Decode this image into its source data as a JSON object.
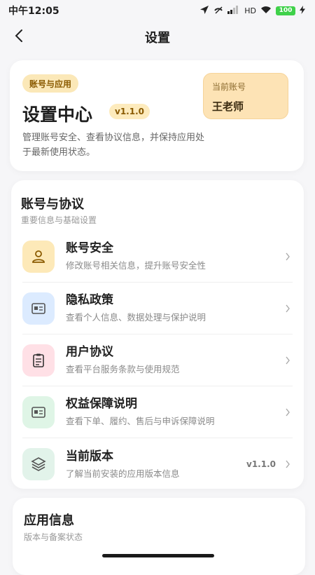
{
  "status_bar": {
    "time": "中午12:05",
    "signal_text": "HD",
    "battery": "100"
  },
  "nav": {
    "title": "设置"
  },
  "hero": {
    "tag": "账号与应用",
    "title": "设置中心",
    "version": "v1.1.0",
    "description": "管理账号安全、查看协议信息，并保持应用处于最新使用状态。",
    "account_label": "当前账号",
    "account_name": "王老师"
  },
  "account_section": {
    "title": "账号与协议",
    "subtitle": "重要信息与基础设置",
    "items": [
      {
        "icon": "user-icon",
        "title": "账号安全",
        "description": "修改账号相关信息，提升账号安全性",
        "value": "",
        "color": "#fde9b8"
      },
      {
        "icon": "id-card-icon",
        "title": "隐私政策",
        "description": "查看个人信息、数据处理与保护说明",
        "value": "",
        "color": "#dcebff"
      },
      {
        "icon": "clipboard-icon",
        "title": "用户协议",
        "description": "查看平台服务条款与使用规范",
        "value": "",
        "color": "#ffe0e6"
      },
      {
        "icon": "id-card-icon",
        "title": "权益保障说明",
        "description": "查看下单、履约、售后与申诉保障说明",
        "value": "",
        "color": "#dff5e6"
      },
      {
        "icon": "layers-icon",
        "title": "当前版本",
        "description": "了解当前安装的应用版本信息",
        "value": "v1.1.0",
        "color": "#e2f3ea"
      }
    ]
  },
  "app_info": {
    "title": "应用信息",
    "subtitle": "版本与备案状态"
  }
}
